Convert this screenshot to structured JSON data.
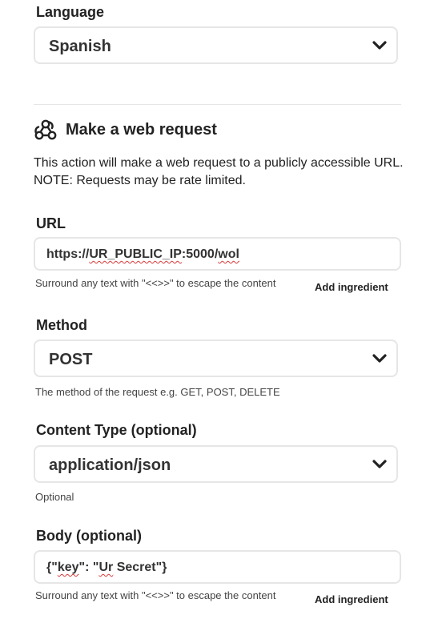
{
  "language": {
    "label": "Language",
    "selected": "Spanish"
  },
  "section": {
    "title": "Make a web request",
    "icon": "webhook-icon",
    "description_line1": "This action will make a web request to a publicly accessible URL.",
    "description_line2": "NOTE: Requests may be rate limited."
  },
  "url": {
    "label": "URL",
    "value_prefix": "https://",
    "value_flagged": "UR_PUBLIC_IP",
    "value_mid": ":5000/",
    "value_flagged2": "wol",
    "helper": "Surround any text with \"<<>>\" to escape the content",
    "add_ingredient": "Add ingredient"
  },
  "method": {
    "label": "Method",
    "selected": "POST",
    "helper": "The method of the request e.g. GET, POST, DELETE"
  },
  "content_type": {
    "label": "Content Type (optional)",
    "selected": "application/json",
    "helper": "Optional"
  },
  "body": {
    "label": "Body (optional)",
    "value_prefix": "{\"",
    "value_flagged": "key",
    "value_mid": "\": \"",
    "value_flagged2": "Ur",
    "value_suffix": " Secret\"}",
    "helper": "Surround any text with \"<<>>\" to escape the content",
    "add_ingredient": "Add ingredient"
  },
  "colors": {
    "border": "#e6e6e6",
    "text": "#222222",
    "spellcheck": "#d83a3a"
  }
}
